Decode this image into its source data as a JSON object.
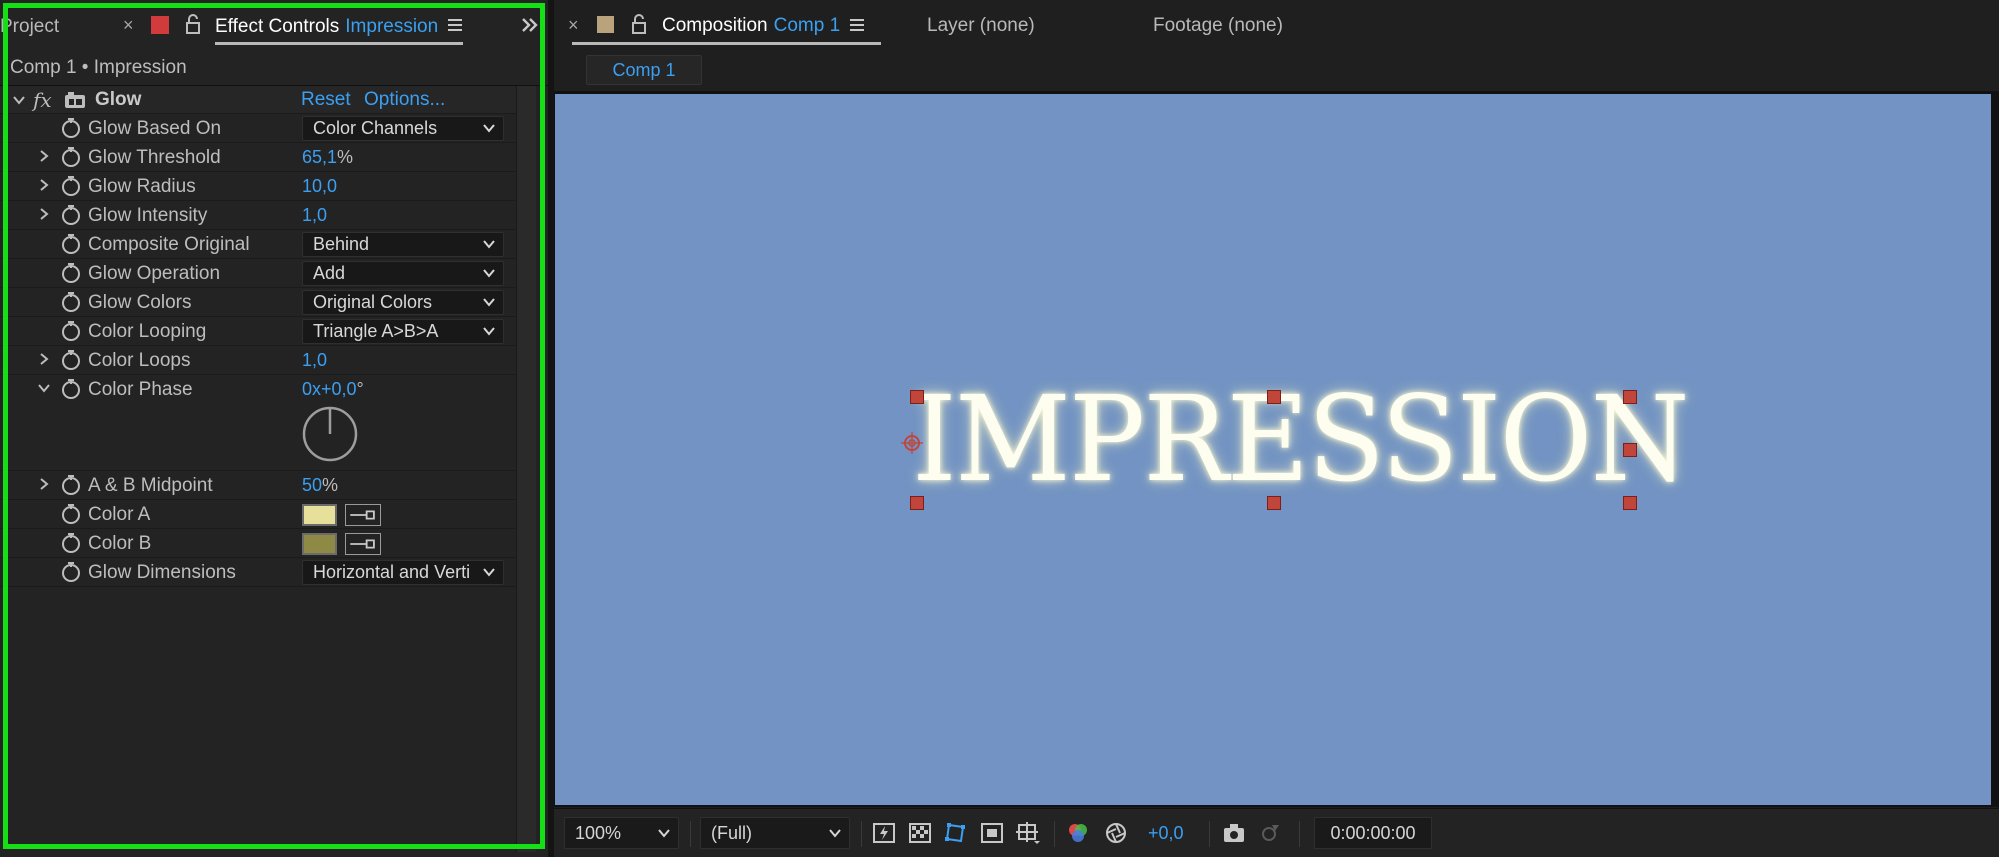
{
  "left_panel": {
    "tabs": {
      "project_label": "Project",
      "effect_controls_label": "Effect Controls",
      "effect_controls_layer": "Impression"
    },
    "breadcrumb": "Comp 1 • Impression",
    "effect": {
      "name": "Glow",
      "reset_label": "Reset",
      "options_label": "Options..."
    },
    "properties": [
      {
        "label": "Glow Based On",
        "dropdown": "Color Channels"
      },
      {
        "label": "Glow Threshold",
        "value": "65,1",
        "unit": "%"
      },
      {
        "label": "Glow Radius",
        "value": "10,0"
      },
      {
        "label": "Glow Intensity",
        "value": "1,0"
      },
      {
        "label": "Composite Original",
        "dropdown": "Behind"
      },
      {
        "label": "Glow Operation",
        "dropdown": "Add"
      },
      {
        "label": "Glow Colors",
        "dropdown": "Original Colors"
      },
      {
        "label": "Color Looping",
        "dropdown": "Triangle A>B>A"
      },
      {
        "label": "Color Loops",
        "value": "1,0"
      },
      {
        "label": "Color Phase",
        "value": "0x+0,0",
        "unit": "°"
      },
      {
        "label": "A & B Midpoint",
        "value": "50",
        "unit": "%"
      },
      {
        "label": "Color A",
        "swatch_color": "#e6e09a"
      },
      {
        "label": "Color B",
        "swatch_color": "#8e8a46"
      },
      {
        "label": "Glow Dimensions",
        "dropdown": "Horizontal and Verti"
      }
    ]
  },
  "right_panel": {
    "tabs": {
      "composition_label": "Composition",
      "composition_name": "Comp 1",
      "layer_label": "Layer (none)",
      "footage_label": "Footage (none)"
    },
    "subtab": "Comp 1",
    "canvas": {
      "background": "#7293c3",
      "text": "IMPRESSION"
    },
    "bottom_bar": {
      "zoom": "100%",
      "resolution": "(Full)",
      "exposure": "+0,0",
      "timecode": "0:00:00:00"
    }
  },
  "colors": {
    "accent_blue": "#3b9ff2",
    "selection_frame": "#15e015",
    "effect_controls_swatch": "#d13b3b",
    "composition_swatch": "#b9a27c"
  }
}
